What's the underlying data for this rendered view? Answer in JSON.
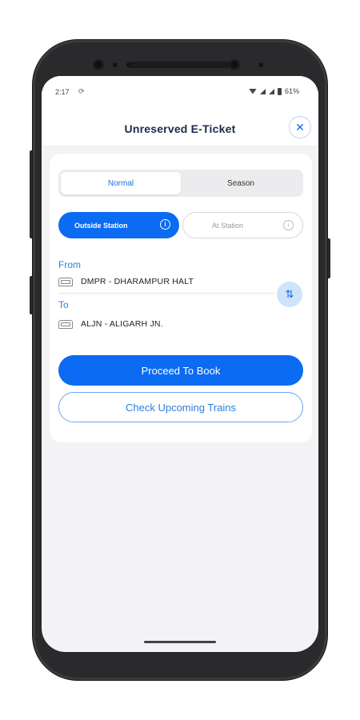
{
  "status_bar": {
    "time": "2:17",
    "battery": "61%"
  },
  "header": {
    "title": "Unreserved E-Ticket",
    "close_icon": "close-icon"
  },
  "ticket_type_tabs": [
    {
      "label": "Normal",
      "selected": true
    },
    {
      "label": "Season",
      "selected": false
    }
  ],
  "location_options": [
    {
      "label": "Outside Station",
      "selected": true
    },
    {
      "label": "At Station",
      "selected": false
    }
  ],
  "journey": {
    "from_label": "From",
    "from_station": "DMPR - DHARAMPUR HALT",
    "to_label": "To",
    "to_station": "ALJN - ALIGARH JN."
  },
  "actions": {
    "proceed_label": "Proceed To Book",
    "check_label": "Check Upcoming Trains"
  },
  "colors": {
    "accent": "#0b6bf2",
    "title": "#1b2a4a"
  }
}
